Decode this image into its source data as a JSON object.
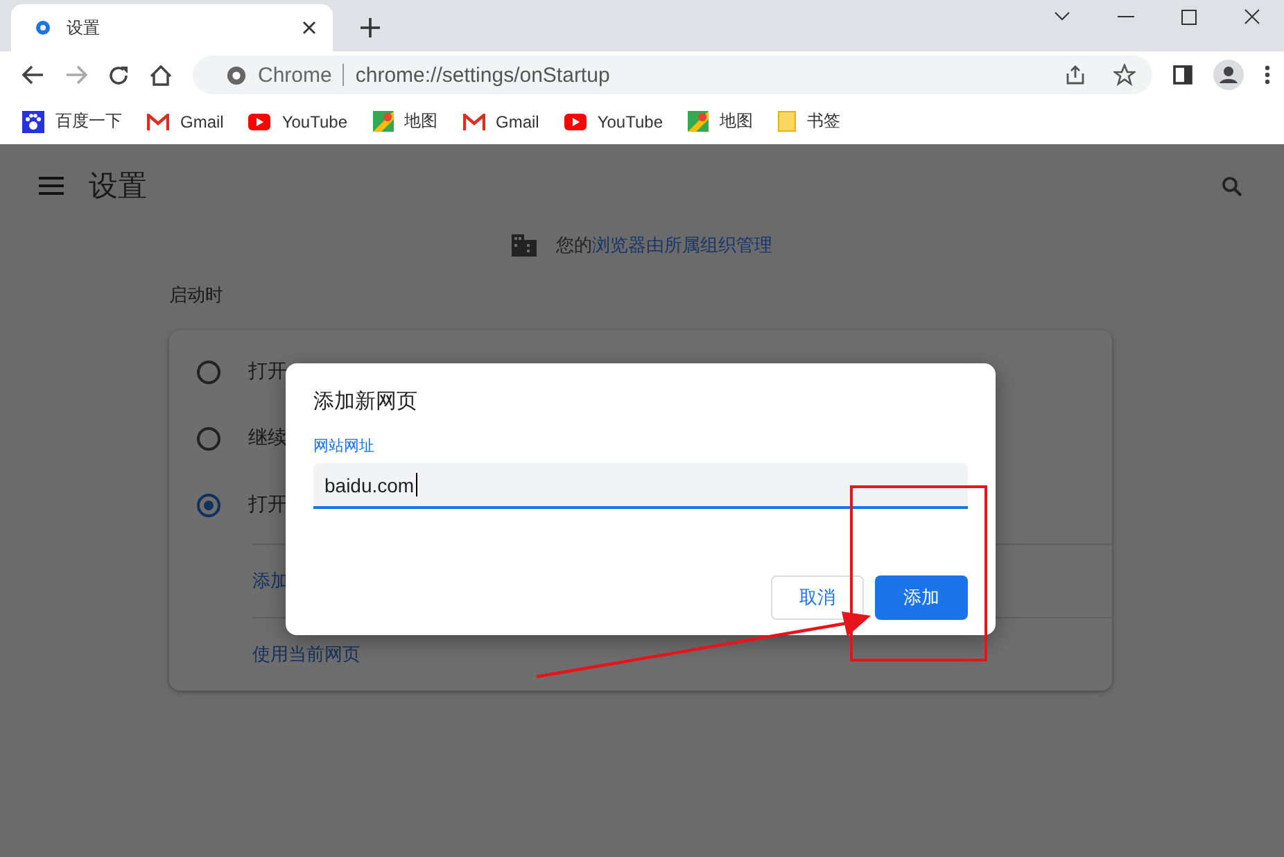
{
  "tabs": [
    {
      "title": "设置",
      "selected": true
    }
  ],
  "omnibox": {
    "chip": "Chrome",
    "url": "chrome://settings/onStartup"
  },
  "bookmarks": [
    {
      "kind": "baidu",
      "label": "百度一下"
    },
    {
      "kind": "gmail",
      "label": "Gmail"
    },
    {
      "kind": "youtube",
      "label": "YouTube"
    },
    {
      "kind": "maps",
      "label": "地图"
    },
    {
      "kind": "gmail",
      "label": "Gmail"
    },
    {
      "kind": "youtube",
      "label": "YouTube"
    },
    {
      "kind": "maps",
      "label": "地图"
    },
    {
      "kind": "folder",
      "label": "书签"
    }
  ],
  "header": {
    "title": "设置"
  },
  "managed_notice": {
    "text": "您的",
    "link": "浏览器由所属组织管理"
  },
  "section": {
    "title": "启动时"
  },
  "startup_options": [
    {
      "label": "打开",
      "selected": false
    },
    {
      "label": "继续",
      "selected": false
    },
    {
      "label": "打开",
      "selected": true
    }
  ],
  "page_links": [
    "添加",
    "使用当前网页"
  ],
  "dialog": {
    "title": "添加新网页",
    "field_label": "网站网址",
    "value": "baidu.com",
    "cancel": "取消",
    "confirm": "添加"
  }
}
